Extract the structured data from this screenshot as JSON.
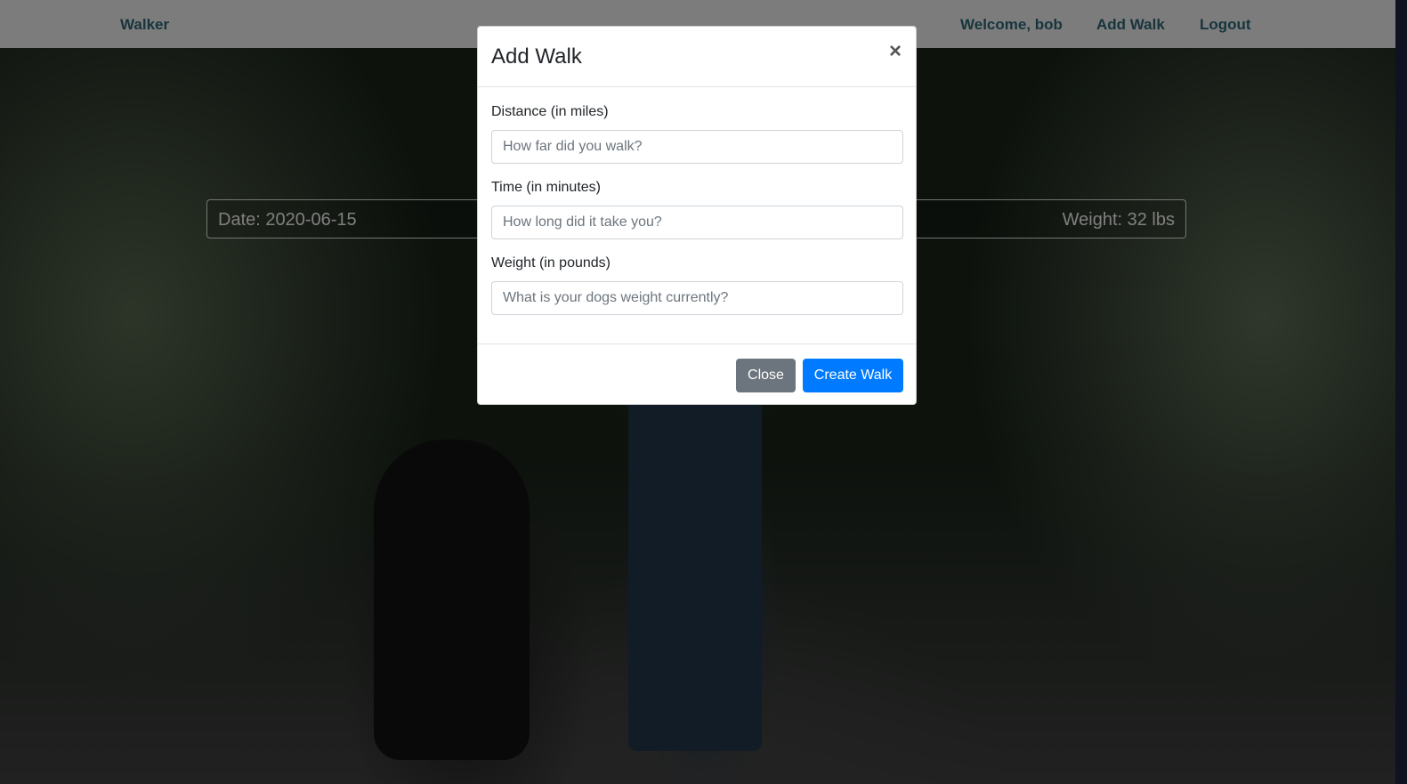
{
  "navbar": {
    "brand": "Walker",
    "welcome": "Welcome, bob",
    "add_walk": "Add Walk",
    "logout": "Logout"
  },
  "walk_card": {
    "date": "Date: 2020-06-15",
    "weight": "Weight: 32 lbs"
  },
  "modal": {
    "title": "Add Walk",
    "close_glyph": "×",
    "fields": [
      {
        "label": "Distance (in miles)",
        "placeholder": "How far did you walk?",
        "value": ""
      },
      {
        "label": "Time (in minutes)",
        "placeholder": "How long did it take you?",
        "value": ""
      },
      {
        "label": "Weight (in pounds)",
        "placeholder": "What is your dogs weight currently?",
        "value": ""
      }
    ],
    "close_button": "Close",
    "create_button": "Create Walk"
  },
  "colors": {
    "nav_link": "#2e6a77",
    "primary": "#007bff",
    "secondary": "#6c757d"
  }
}
